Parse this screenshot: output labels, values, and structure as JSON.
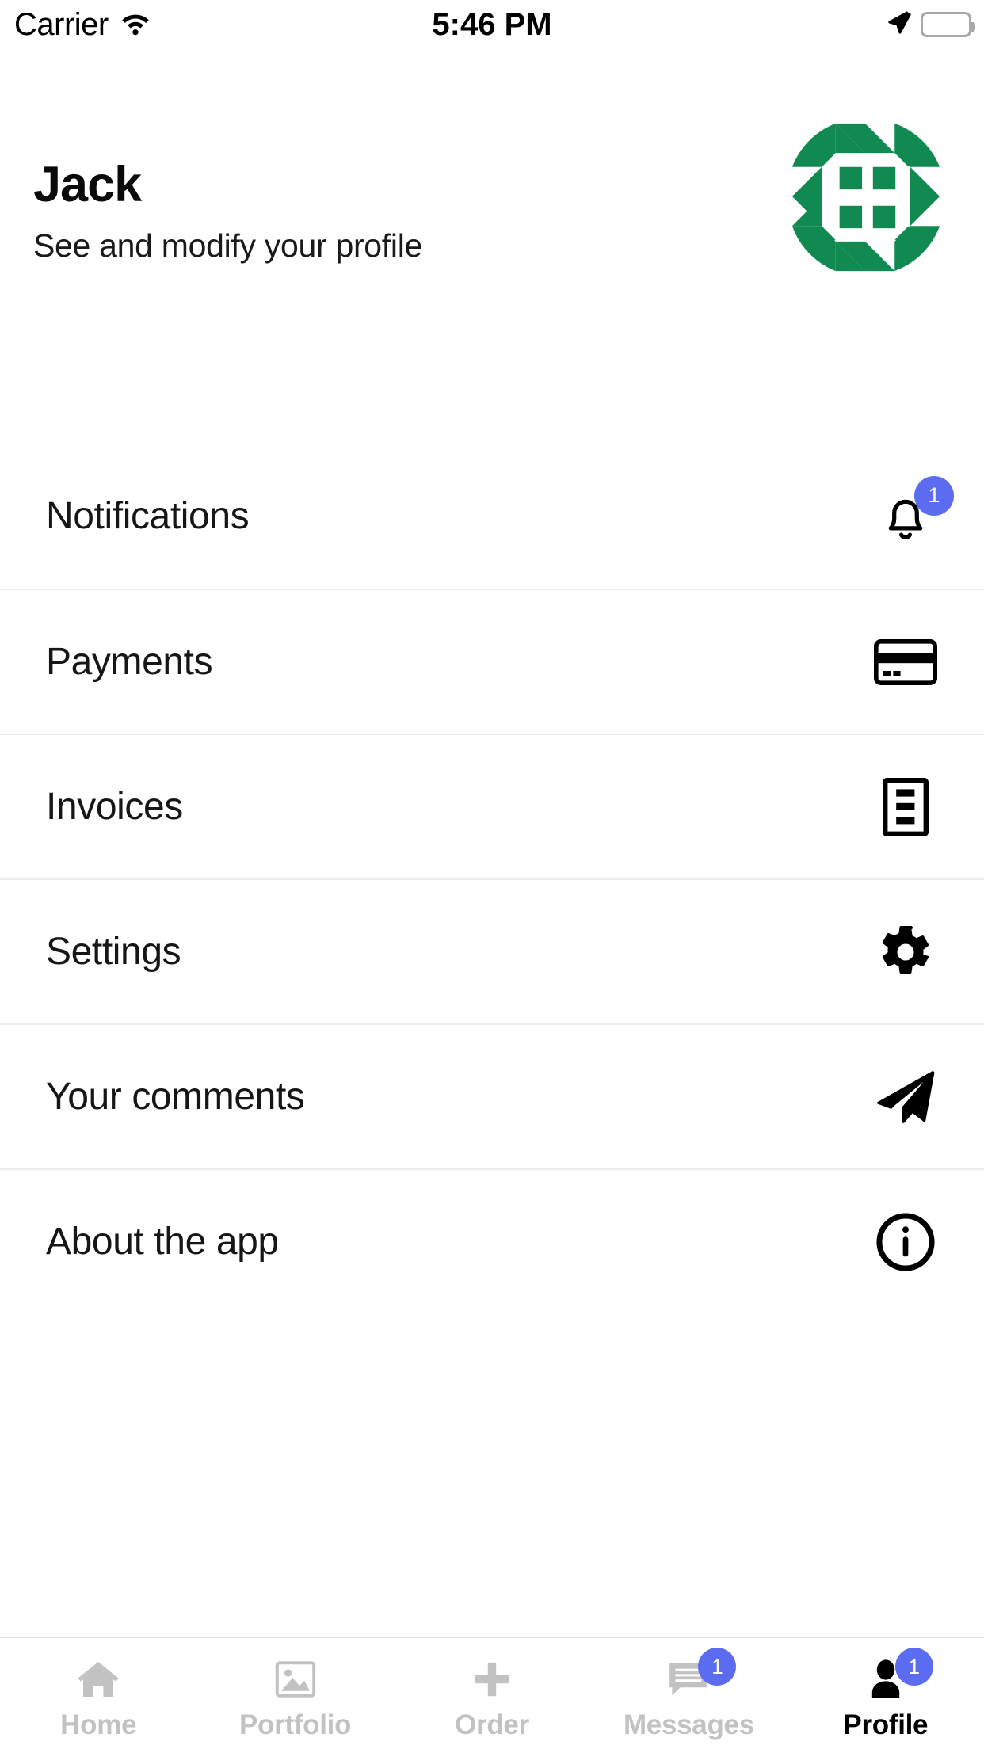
{
  "status_bar": {
    "carrier": "Carrier",
    "time": "5:46 PM",
    "wifi_icon": "wifi-icon",
    "location_icon": "location-arrow-icon",
    "battery_icon": "battery-full-icon"
  },
  "header": {
    "name": "Jack",
    "subtitle": "See and modify your profile",
    "logo_icon": "app-logo-geometric-mandala",
    "logo_color": "#118A52"
  },
  "menu": {
    "items": [
      {
        "label": "Notifications",
        "icon": "bell-icon",
        "badge": "1"
      },
      {
        "label": "Payments",
        "icon": "credit-card-icon",
        "badge": ""
      },
      {
        "label": "Invoices",
        "icon": "document-list-icon",
        "badge": ""
      },
      {
        "label": "Settings",
        "icon": "gear-icon",
        "badge": ""
      },
      {
        "label": "Your comments",
        "icon": "paper-plane-icon",
        "badge": ""
      },
      {
        "label": "About the app",
        "icon": "info-circle-icon",
        "badge": ""
      }
    ]
  },
  "tabbar": {
    "items": [
      {
        "label": "Home",
        "icon": "home-icon",
        "badge": "",
        "active": false
      },
      {
        "label": "Portfolio",
        "icon": "image-icon",
        "badge": "",
        "active": false
      },
      {
        "label": "Order",
        "icon": "plus-icon",
        "badge": "",
        "active": false
      },
      {
        "label": "Messages",
        "icon": "chat-icon",
        "badge": "1",
        "active": false
      },
      {
        "label": "Profile",
        "icon": "person-icon",
        "badge": "1",
        "active": true
      }
    ]
  },
  "colors": {
    "badge_blue": "#5B6CF0",
    "brand_green": "#118A52",
    "inactive_gray": "#c2c2c2",
    "divider": "#ededed"
  }
}
